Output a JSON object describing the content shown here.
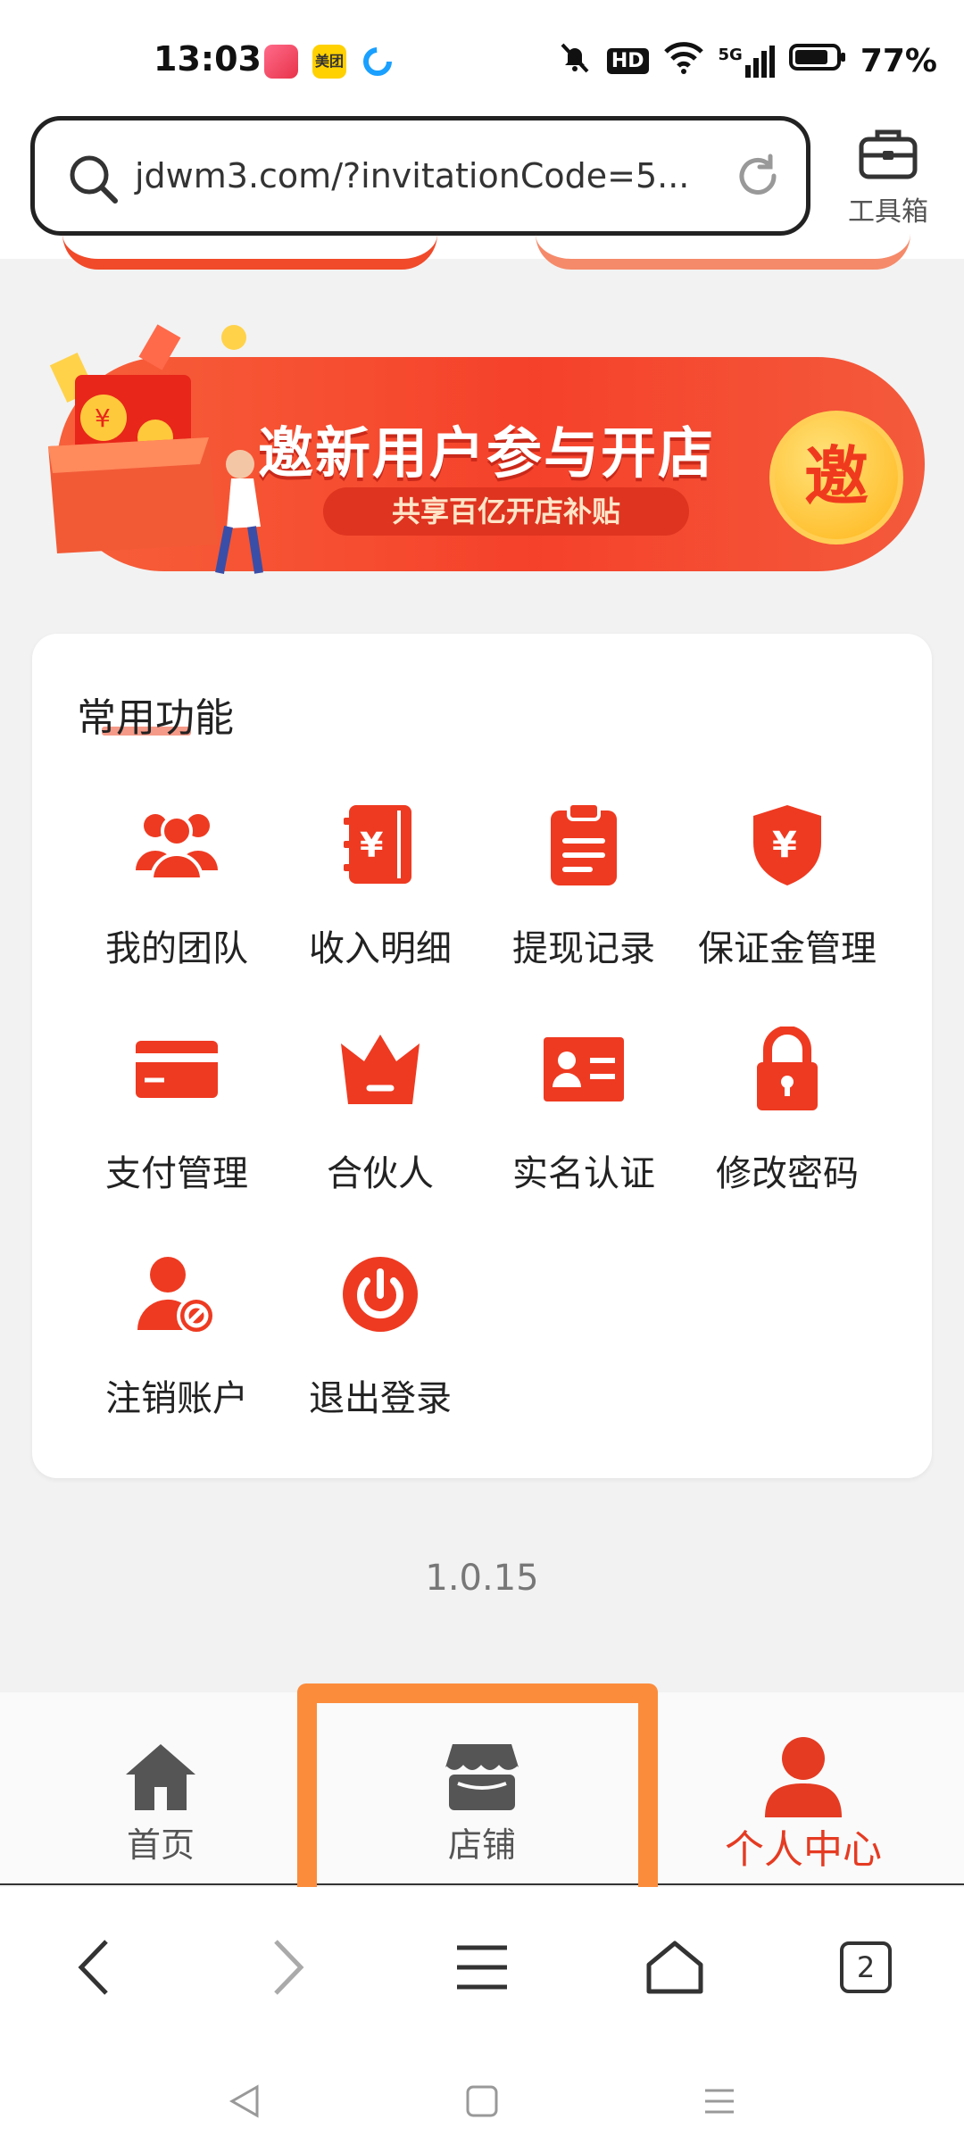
{
  "status_bar": {
    "time": "13:03",
    "battery": "77%",
    "signal_label": "5G",
    "hd_label": "HD",
    "app_meituan": "美团"
  },
  "url_bar": {
    "url": "jdwm3.com/?invitationCode=5..."
  },
  "toolbox": {
    "label": "工具箱"
  },
  "banner": {
    "title": "邀新用户参与开店",
    "subtitle": "共享百亿开店补贴",
    "badge": "邀"
  },
  "common_functions": {
    "title": "常用功能",
    "items": [
      {
        "label": "我的团队",
        "icon": "team-icon"
      },
      {
        "label": "收入明细",
        "icon": "income-ledger-icon"
      },
      {
        "label": "提现记录",
        "icon": "clipboard-icon"
      },
      {
        "label": "保证金管理",
        "icon": "yuan-shield-icon"
      },
      {
        "label": "支付管理",
        "icon": "card-icon"
      },
      {
        "label": "合伙人",
        "icon": "crown-icon"
      },
      {
        "label": "实名认证",
        "icon": "id-card-icon"
      },
      {
        "label": "修改密码",
        "icon": "lock-icon"
      },
      {
        "label": "注销账户",
        "icon": "user-ban-icon"
      },
      {
        "label": "退出登录",
        "icon": "power-icon"
      }
    ]
  },
  "version": "1.0.15",
  "tabs": [
    {
      "label": "首页",
      "icon": "home-icon",
      "active": false
    },
    {
      "label": "店铺",
      "icon": "store-icon",
      "active": false
    },
    {
      "label": "个人中心",
      "icon": "user-icon",
      "active": true
    }
  ],
  "browser_nav": {
    "tab_count": "2"
  },
  "colors": {
    "accent": "#e53b22",
    "highlight": "#fb8c3c",
    "page_bg": "#f2f2f2"
  }
}
